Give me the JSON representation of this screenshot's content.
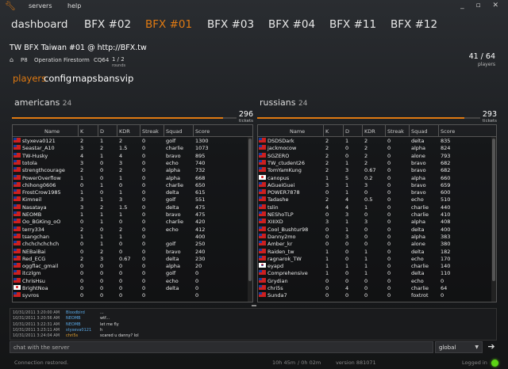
{
  "menu": {
    "servers": "servers",
    "help": "help"
  },
  "window_buttons": "_ ▫ ✕",
  "server_tabs": [
    "dashboard",
    "BFX #02",
    "BFX #01",
    "BFX #03",
    "BFX #04",
    "BFX #11",
    "BFX #12"
  ],
  "server": {
    "title": "TW BFX Taiwan #01 @ http://BFX.tw",
    "code": "P8",
    "map": "Operation Firestorm",
    "mode": "CQ64",
    "rounds": "1 / 2",
    "rounds_label": "rounds",
    "players": "41 / 64",
    "players_label": "players"
  },
  "sub_tabs": [
    "players",
    "config",
    "maps",
    "bans",
    "vip"
  ],
  "columns": [
    "Name",
    "K",
    "D",
    "KDR",
    "Streak",
    "Squad",
    "Score"
  ],
  "teams": {
    "left": {
      "name": "americans",
      "count": "24",
      "tickets": "296",
      "tickets_label": "tickets",
      "ticket_fill": 0.94,
      "players": [
        {
          "flag": "tw",
          "name": "styxeva0121",
          "k": "2",
          "d": "1",
          "kdr": "2",
          "streak": "0",
          "squad": "golf",
          "score": "1300"
        },
        {
          "flag": "tw",
          "name": "Seastar_A10",
          "k": "3",
          "d": "2",
          "kdr": "1.5",
          "streak": "0",
          "squad": "charlie",
          "score": "1073"
        },
        {
          "flag": "tw",
          "name": "TW-Husky",
          "k": "4",
          "d": "1",
          "kdr": "4",
          "streak": "0",
          "squad": "bravo",
          "score": "895"
        },
        {
          "flag": "tw",
          "name": "totola",
          "k": "3",
          "d": "0",
          "kdr": "3",
          "streak": "0",
          "squad": "echo",
          "score": "740"
        },
        {
          "flag": "tw",
          "name": "strengthcourage",
          "k": "2",
          "d": "0",
          "kdr": "2",
          "streak": "0",
          "squad": "alpha",
          "score": "732"
        },
        {
          "flag": "tw",
          "name": "PowerOverflow",
          "k": "1",
          "d": "0",
          "kdr": "1",
          "streak": "0",
          "squad": "alpha",
          "score": "668"
        },
        {
          "flag": "tw",
          "name": "chihong0606",
          "k": "0",
          "d": "1",
          "kdr": "0",
          "streak": "0",
          "squad": "charlie",
          "score": "650"
        },
        {
          "flag": "tw",
          "name": "FrostCrow1985",
          "k": "1",
          "d": "0",
          "kdr": "1",
          "streak": "0",
          "squad": "delta",
          "score": "615"
        },
        {
          "flag": "tw",
          "name": "Kimneil",
          "k": "3",
          "d": "1",
          "kdr": "3",
          "streak": "0",
          "squad": "golf",
          "score": "551"
        },
        {
          "flag": "tw",
          "name": "Nasataya",
          "k": "3",
          "d": "2",
          "kdr": "1.5",
          "streak": "0",
          "squad": "delta",
          "score": "475"
        },
        {
          "flag": "tw",
          "name": "NEOMB",
          "k": "1",
          "d": "1",
          "kdr": "1",
          "streak": "0",
          "squad": "bravo",
          "score": "475"
        },
        {
          "flag": "tw",
          "name": "Oo_BGKing_oO",
          "k": "0",
          "d": "1",
          "kdr": "0",
          "streak": "0",
          "squad": "charlie",
          "score": "420"
        },
        {
          "flag": "tw",
          "name": "terry334",
          "k": "2",
          "d": "0",
          "kdr": "2",
          "streak": "0",
          "squad": "echo",
          "score": "412"
        },
        {
          "flag": "tw",
          "name": "tsangchan",
          "k": "1",
          "d": "1",
          "kdr": "1",
          "streak": "0",
          "squad": "",
          "score": "400"
        },
        {
          "flag": "tw",
          "name": "chchchchchch",
          "k": "0",
          "d": "1",
          "kdr": "0",
          "streak": "0",
          "squad": "golf",
          "score": "250"
        },
        {
          "flag": "tw",
          "name": "NEBaiBai",
          "k": "0",
          "d": "2",
          "kdr": "0",
          "streak": "0",
          "squad": "bravo",
          "score": "240"
        },
        {
          "flag": "tw",
          "name": "Red_ECG",
          "k": "2",
          "d": "3",
          "kdr": "0.67",
          "streak": "0",
          "squad": "delta",
          "score": "230"
        },
        {
          "flag": "tw",
          "name": "oggflac_gmail",
          "k": "0",
          "d": "0",
          "kdr": "0",
          "streak": "0",
          "squad": "alpha",
          "score": "20"
        },
        {
          "flag": "tw",
          "name": "itczlgm",
          "k": "0",
          "d": "0",
          "kdr": "0",
          "streak": "0",
          "squad": "golf",
          "score": "0"
        },
        {
          "flag": "tw",
          "name": "ChrisHsu",
          "k": "0",
          "d": "0",
          "kdr": "0",
          "streak": "0",
          "squad": "echo",
          "score": "0"
        },
        {
          "flag": "jp",
          "name": "BrightNoa",
          "k": "0",
          "d": "0",
          "kdr": "0",
          "streak": "0",
          "squad": "delta",
          "score": "0"
        },
        {
          "flag": "tw",
          "name": "syvros",
          "k": "0",
          "d": "0",
          "kdr": "0",
          "streak": "0",
          "squad": "",
          "score": "0"
        }
      ]
    },
    "right": {
      "name": "russians",
      "count": "24",
      "tickets": "293",
      "tickets_label": "tickets",
      "ticket_fill": 0.93,
      "players": [
        {
          "flag": "tw",
          "name": "DSDSDark",
          "k": "2",
          "d": "1",
          "kdr": "2",
          "streak": "0",
          "squad": "delta",
          "score": "835"
        },
        {
          "flag": "tw",
          "name": "jackmocow",
          "k": "2",
          "d": "0",
          "kdr": "2",
          "streak": "0",
          "squad": "alpha",
          "score": "824"
        },
        {
          "flag": "tw",
          "name": "SGZERO",
          "k": "2",
          "d": "0",
          "kdr": "2",
          "streak": "0",
          "squad": "alone",
          "score": "793"
        },
        {
          "flag": "tw",
          "name": "TW_ctudent26",
          "k": "2",
          "d": "1",
          "kdr": "2",
          "streak": "0",
          "squad": "bravo",
          "score": "682"
        },
        {
          "flag": "tw",
          "name": "TomYamKung",
          "k": "2",
          "d": "3",
          "kdr": "0.67",
          "streak": "0",
          "squad": "bravo",
          "score": "682"
        },
        {
          "flag": "jp",
          "name": "canopus",
          "k": "1",
          "d": "5",
          "kdr": "0.2",
          "streak": "0",
          "squad": "alpha",
          "score": "660"
        },
        {
          "flag": "tw",
          "name": "AGueiGuei",
          "k": "3",
          "d": "1",
          "kdr": "3",
          "streak": "0",
          "squad": "bravo",
          "score": "659"
        },
        {
          "flag": "tw",
          "name": "POWER7878",
          "k": "0",
          "d": "1",
          "kdr": "0",
          "streak": "0",
          "squad": "bravo",
          "score": "600"
        },
        {
          "flag": "tw",
          "name": "Tadashe",
          "k": "2",
          "d": "4",
          "kdr": "0.5",
          "streak": "0",
          "squad": "echo",
          "score": "510"
        },
        {
          "flag": "tw",
          "name": "tslin",
          "k": "4",
          "d": "4",
          "kdr": "1",
          "streak": "0",
          "squad": "charlie",
          "score": "440"
        },
        {
          "flag": "tw",
          "name": "NEShoTLP",
          "k": "0",
          "d": "3",
          "kdr": "0",
          "streak": "0",
          "squad": "charlie",
          "score": "410"
        },
        {
          "flag": "tw",
          "name": "XIIIXD",
          "k": "3",
          "d": "1",
          "kdr": "3",
          "streak": "0",
          "squad": "alpha",
          "score": "408"
        },
        {
          "flag": "tw",
          "name": "Cool_Bushtur98",
          "k": "0",
          "d": "1",
          "kdr": "0",
          "streak": "0",
          "squad": "delta",
          "score": "400"
        },
        {
          "flag": "tw",
          "name": "Danny2mo",
          "k": "0",
          "d": "3",
          "kdr": "0",
          "streak": "0",
          "squad": "alpha",
          "score": "383"
        },
        {
          "flag": "tw",
          "name": "Amber_kr",
          "k": "0",
          "d": "0",
          "kdr": "0",
          "streak": "0",
          "squad": "alone",
          "score": "380"
        },
        {
          "flag": "tw",
          "name": "Raiden_tw",
          "k": "1",
          "d": "0",
          "kdr": "1",
          "streak": "0",
          "squad": "delta",
          "score": "182"
        },
        {
          "flag": "tw",
          "name": "ragnarok_TW",
          "k": "1",
          "d": "0",
          "kdr": "1",
          "streak": "0",
          "squad": "echo",
          "score": "170"
        },
        {
          "flag": "kr",
          "name": "eyapd",
          "k": "1",
          "d": "1",
          "kdr": "1",
          "streak": "0",
          "squad": "charlie",
          "score": "140"
        },
        {
          "flag": "tw",
          "name": "Comprehensive",
          "k": "1",
          "d": "0",
          "kdr": "1",
          "streak": "0",
          "squad": "delta",
          "score": "110"
        },
        {
          "flag": "tw",
          "name": "Grydian",
          "k": "0",
          "d": "0",
          "kdr": "0",
          "streak": "0",
          "squad": "echo",
          "score": "0"
        },
        {
          "flag": "tw",
          "name": "chri5s",
          "k": "0",
          "d": "4",
          "kdr": "0",
          "streak": "0",
          "squad": "charlie",
          "score": "64"
        },
        {
          "flag": "tw",
          "name": "Sunda7",
          "k": "0",
          "d": "0",
          "kdr": "0",
          "streak": "0",
          "squad": "foxtrot",
          "score": "0"
        }
      ]
    }
  },
  "chat": [
    {
      "time": "10/31/2011 3:20:00 AM",
      "name": "Bloodbird",
      "msg": "...",
      "own": false
    },
    {
      "time": "10/31/2011 3:20:56 AM",
      "name": "NEOMB",
      "msg": "wtf...",
      "own": false
    },
    {
      "time": "10/31/2011 3:22:31 AM",
      "name": "NEOMB",
      "msg": "let me fly",
      "own": false
    },
    {
      "time": "10/31/2011 3:23:11 AM",
      "name": "styxeva0121",
      "msg": "h",
      "own": false
    },
    {
      "time": "10/31/2011 3:24:04 AM",
      "name": "chri5s",
      "msg": "scared u danny? lol",
      "own": true
    }
  ],
  "chat_input": {
    "placeholder": "chat with the server",
    "scope": "global",
    "scope_arrow": "▼",
    "send": "➔"
  },
  "status": {
    "message": "Connection restored.",
    "uptime": "10h 45m",
    "elapsed": "/ 0h 02m",
    "version": "version 881071",
    "logged_in": "Logged in"
  }
}
